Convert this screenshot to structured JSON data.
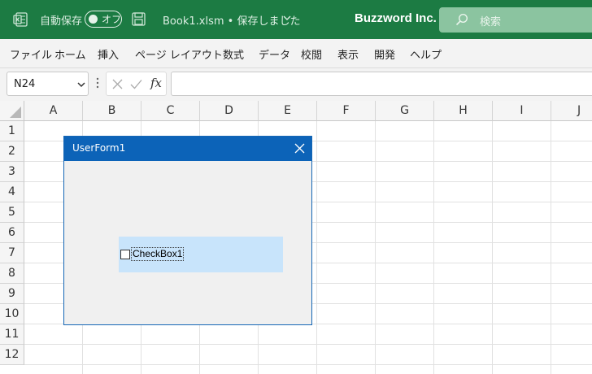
{
  "titlebar": {
    "autosave_label": "自動保存",
    "autosave_state": "オフ",
    "doc_name": "Book1.xlsm",
    "separator": "•",
    "save_status": "保存しました",
    "company": "Buzzword Inc.",
    "search_placeholder": "検索",
    "accent_color": "#1c7b43"
  },
  "ribbon": {
    "tabs": [
      "ファイル",
      "ホーム",
      "挿入",
      "ページ レイアウト",
      "数式",
      "データ",
      "校閲",
      "表示",
      "開発",
      "ヘルプ"
    ]
  },
  "formula_bar": {
    "name_box": "N24",
    "fx_label": "fx",
    "formula": ""
  },
  "grid": {
    "columns": [
      "A",
      "B",
      "C",
      "D",
      "E",
      "F",
      "G",
      "H",
      "I",
      "J"
    ],
    "rows": [
      "1",
      "2",
      "3",
      "4",
      "5",
      "6",
      "7",
      "8",
      "9",
      "10",
      "11",
      "12"
    ]
  },
  "userform": {
    "title": "UserForm1",
    "checkbox_label": "CheckBox1",
    "checkbox_checked": false,
    "title_color": "#0c63b8",
    "checkbox_bg": "#c8e4fb"
  }
}
